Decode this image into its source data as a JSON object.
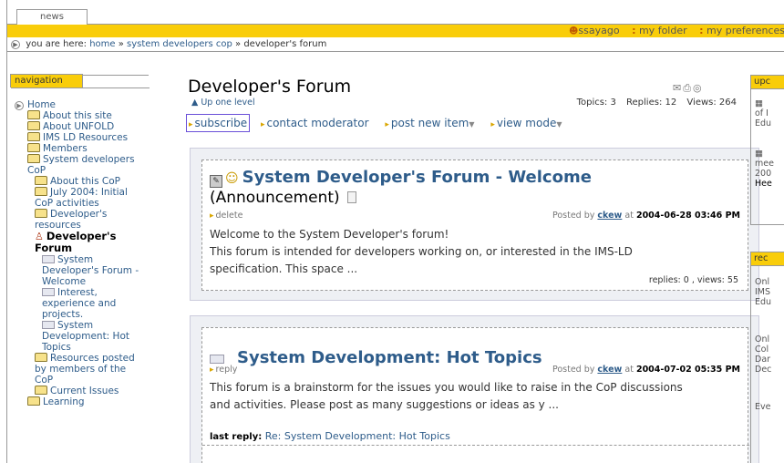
{
  "tabs": {
    "news": "news"
  },
  "personal_bar": {
    "user": "ssayago",
    "folder": "my folder",
    "preferences": "my preferences"
  },
  "breadcrumb": {
    "prefix": "you are here:",
    "home": "home",
    "sep1": "»",
    "item1": "system developers cop",
    "sep2": "»",
    "current": "developer's forum"
  },
  "navigation": {
    "title": "navigation",
    "items": [
      {
        "label": "Home"
      },
      {
        "label": "About this site"
      },
      {
        "label": "About UNFOLD"
      },
      {
        "label": "IMS LD Resources"
      },
      {
        "label": "Members"
      },
      {
        "label": "System developers CoP"
      },
      {
        "label": "About this CoP"
      },
      {
        "label": "July 2004: Initial CoP activities"
      },
      {
        "label": "Developer's resources"
      },
      {
        "label": "Developer's Forum"
      },
      {
        "label": "System Developer's Forum - Welcome"
      },
      {
        "label": "Interest, experience and projects."
      },
      {
        "label": "System Development: Hot Topics"
      },
      {
        "label": "Resources posted by members of the CoP"
      },
      {
        "label": "Current Issues"
      },
      {
        "label": "Learning"
      }
    ]
  },
  "main": {
    "title": "Developer's Forum",
    "up_level": "Up one level",
    "stats": {
      "topics": "Topics: 3",
      "replies": "Replies: 12",
      "views": "Views: 264"
    },
    "actions": {
      "subscribe": "subscribe",
      "contact": "contact moderator",
      "post": "post new item",
      "view": "view mode"
    },
    "posts": [
      {
        "title": "System Developer's Forum - Welcome",
        "subtitle": "(Announcement)",
        "action": "delete",
        "posted_by": "Posted by",
        "author": "ckew",
        "at": "at",
        "date": "2004-06-28 03:46 PM",
        "body1": "Welcome to the System Developer's forum!",
        "body2": "This forum is intended for developers working on, or interested in the IMS-LD",
        "body3": "specification. This space ...",
        "footer": "replies: 0 , views: 55"
      },
      {
        "title": "System Development: Hot Topics",
        "action": "reply",
        "posted_by": "Posted by",
        "author": "ckew",
        "at": "at",
        "date": "2004-07-02 05:35 PM",
        "body1": "This forum is a brainstorm for the issues you would like to raise in the CoP discussions",
        "body2": "and activities. Please post as many suggestions or ideas as y ...",
        "last_reply_label": "last reply:",
        "last_reply": "Re: System Development: Hot Topics"
      }
    ]
  },
  "right": {
    "upcoming": {
      "title": "upc",
      "lines1": [
        "of I",
        "Edu"
      ],
      "lines2": [
        "mee",
        "200",
        "Hee"
      ]
    },
    "recent": {
      "title": "rec",
      "lines1": [
        "Onl",
        "IMS",
        "Edu"
      ],
      "lines2": [
        "Onl",
        "Col",
        "Dar",
        "Dec"
      ],
      "lines3": [
        "Eve"
      ]
    }
  }
}
